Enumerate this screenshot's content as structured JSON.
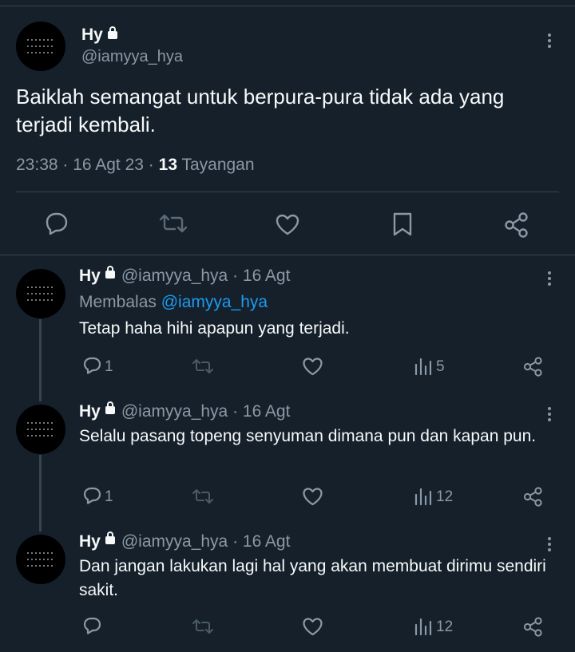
{
  "main_tweet": {
    "name": "Hy",
    "handle": "@iamyya_hya",
    "text": "Baiklah semangat untuk berpura-pura tidak ada yang terjadi kembali.",
    "time": "23:38 · 16 Agt 23 ·",
    "views_count": "13",
    "views_label": "Tayangan",
    "actions": [
      "reply-icon",
      "retweet-icon",
      "like-icon",
      "bookmark-icon",
      "share-icon"
    ]
  },
  "replies": [
    {
      "name": "Hy",
      "handle": "@iamyya_hya · 16 Agt",
      "replying_label": "Membalas",
      "replying_to": "@iamyya_hya",
      "text": "Tetap haha hihi apapun yang terjadi.",
      "reply_count": "1",
      "views": "5"
    },
    {
      "name": "Hy",
      "handle": "@iamyya_hya · 16 Agt",
      "text": "Selalu pasang topeng senyuman dimana pun dan kapan pun.",
      "reply_count": "1",
      "views": "12"
    },
    {
      "name": "Hy",
      "handle": "@iamyya_hya · 16 Agt",
      "text": "Dan jangan lakukan lagi hal yang akan membuat dirimu sendiri sakit.",
      "reply_count": "",
      "views": "12"
    }
  ],
  "colors": {
    "background": "#15202b",
    "text": "#f7f9f9",
    "muted": "#8b98a5",
    "link": "#1d9bf0",
    "border": "#38444d"
  }
}
